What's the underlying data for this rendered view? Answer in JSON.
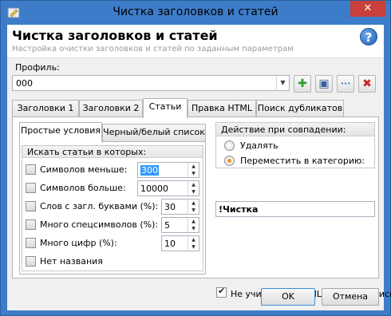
{
  "window": {
    "title": "Чистка заголовков и статей",
    "close_glyph": "✕"
  },
  "header": {
    "title": "Чистка заголовков и статей",
    "subtitle": "Настройка очистки заголовков и статей по заданным параметрам",
    "help_glyph": "?"
  },
  "profile": {
    "label": "Профиль:",
    "value": "000",
    "buttons": [
      {
        "icon": "add-icon",
        "glyph": "✚",
        "color": "#2f9a2f"
      },
      {
        "icon": "save-icon",
        "glyph": "▣",
        "color": "#3a5f9a"
      },
      {
        "icon": "more-icon",
        "glyph": "···",
        "color": "#2a7ad0"
      },
      {
        "icon": "delete-icon",
        "glyph": "✖",
        "color": "#d02727"
      }
    ]
  },
  "tabs": [
    "Заголовки 1",
    "Заголовки 2",
    "Статьи",
    "Правка HTML",
    "Поиск дубликатов"
  ],
  "active_tab": "Статьи",
  "subtabs": [
    "Простые условия",
    "Черный/белый список"
  ],
  "active_subtab": "Простые условия",
  "conditions": {
    "group_title": "Искать статьи в которых:",
    "rows": [
      {
        "label": "Символов меньше:",
        "value": "300",
        "checked": false
      },
      {
        "label": "Символов больше:",
        "value": "10000",
        "checked": false
      },
      {
        "label": "Слов с загл. буквами (%):",
        "value": "30",
        "checked": false
      },
      {
        "label": "Много спецсимволов (%):",
        "value": "5",
        "checked": false
      },
      {
        "label": "Много цифр (%):",
        "value": "10",
        "checked": false
      },
      {
        "label": "Нет названия",
        "value": null,
        "checked": false
      }
    ]
  },
  "action": {
    "title": "Действие при совпадении:",
    "options": [
      {
        "label": "Удалять",
        "selected": false
      },
      {
        "label": "Переместить в категорию:",
        "selected": true
      }
    ],
    "category_value": "!Чистка"
  },
  "ignore_html": {
    "label": "Не учитывать HTML теги при поиске",
    "checked": true
  },
  "footer": {
    "ok_label": "OK",
    "cancel_label": "Отмена"
  },
  "colors": {
    "window_frame": "#3d7cc9",
    "close_button": "#c7403a",
    "selection": "#3399ff",
    "radio_dot": "#e69a1e"
  }
}
